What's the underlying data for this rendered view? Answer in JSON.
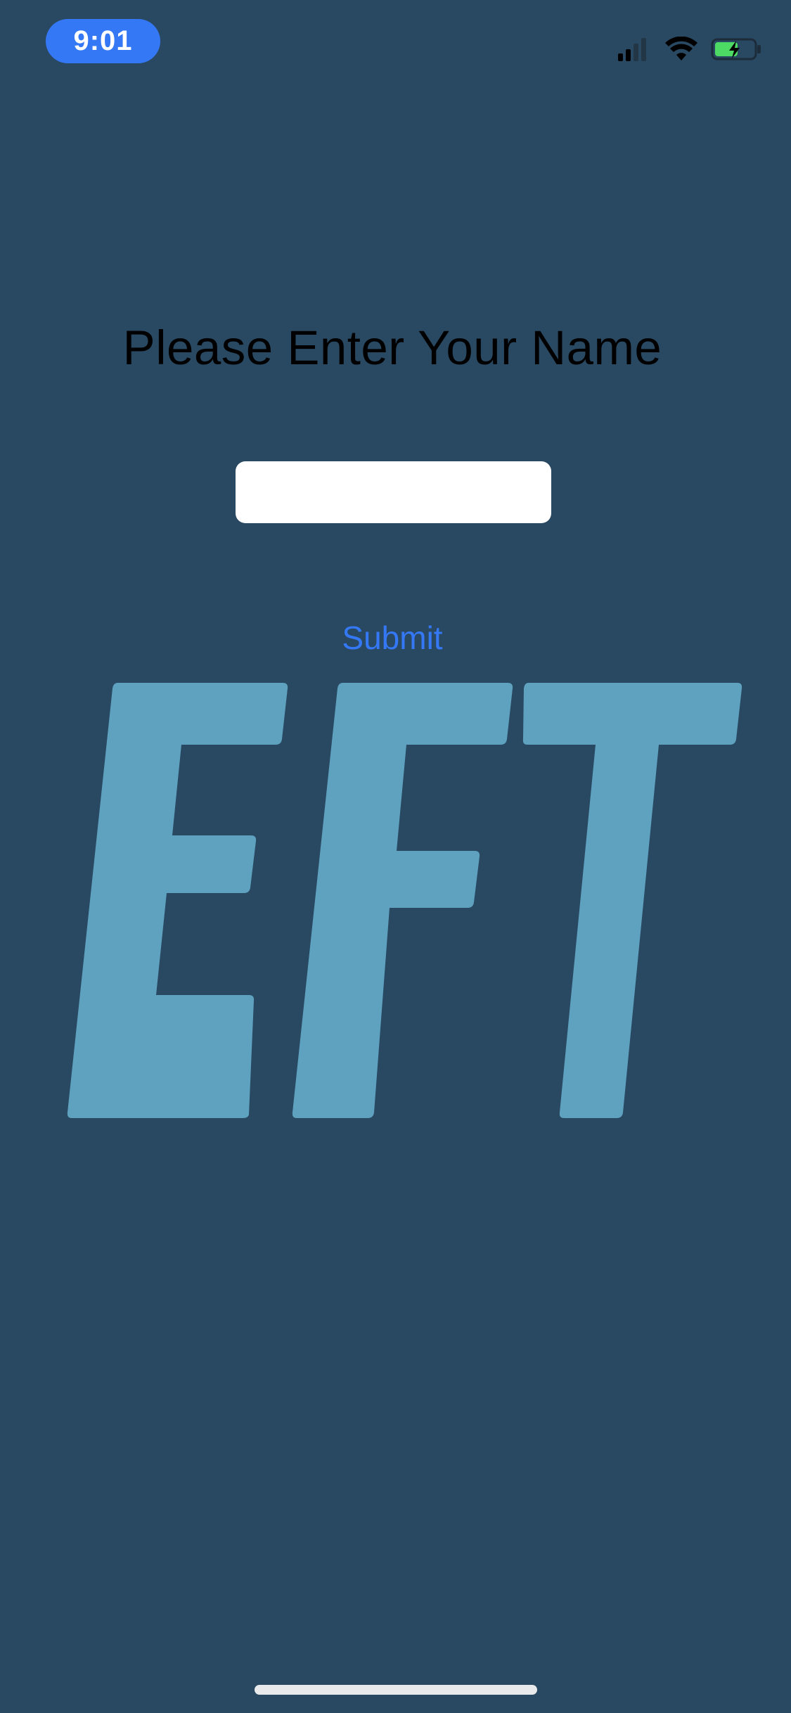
{
  "status_bar": {
    "time": "9:01",
    "time_pill_color": "#3478f6",
    "signal_strength_bars": 2,
    "signal_total_bars": 4,
    "wifi_icon": "wifi-icon",
    "battery_icon": "battery-charging-icon",
    "battery_color": "#4cd964"
  },
  "prompt": {
    "title": "Please Enter Your Name",
    "name_input_value": "",
    "name_input_placeholder": "",
    "submit_label": "Submit",
    "submit_color": "#3478f6"
  },
  "logo": {
    "text": "EFT",
    "color": "#5fa2c0"
  },
  "theme": {
    "background": "#294963"
  }
}
